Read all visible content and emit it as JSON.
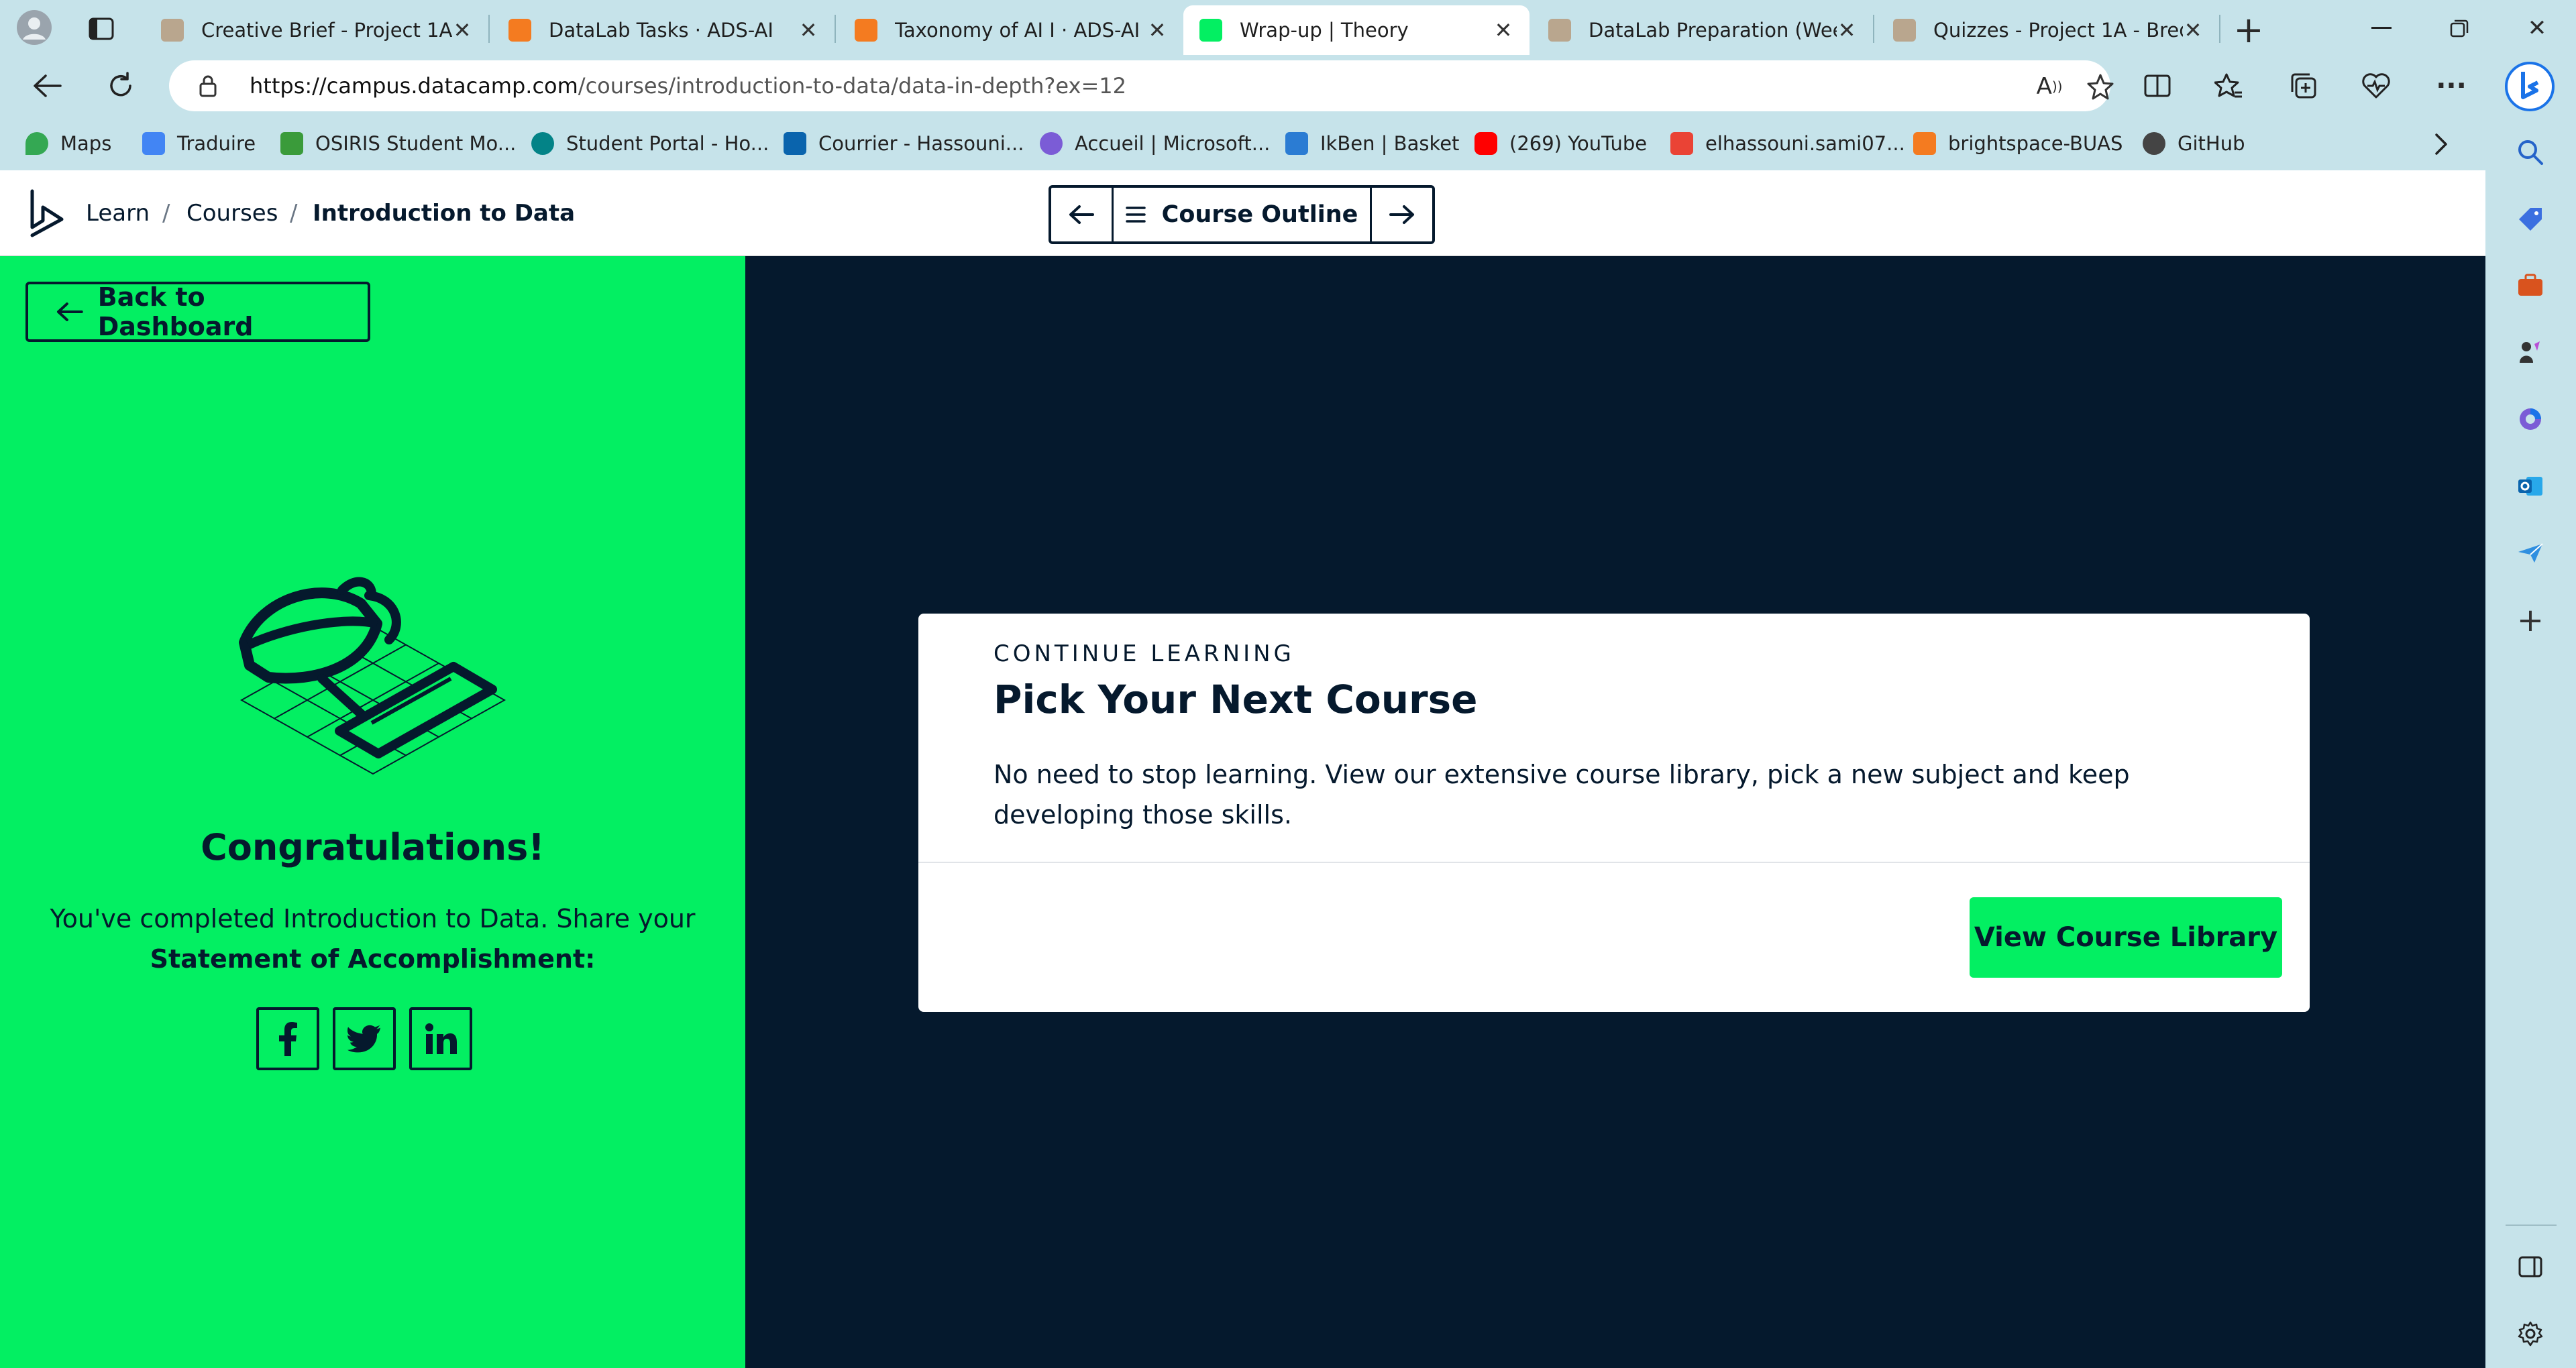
{
  "browser": {
    "tabs": [
      {
        "title": "Creative Brief - Project 1A",
        "favicon": "brightspace-icon",
        "color": "#b9a68e",
        "active": false
      },
      {
        "title": "DataLab Tasks · ADS-AI",
        "favicon": "brightspace-icon",
        "color": "#f47b20",
        "active": false
      },
      {
        "title": "Taxonomy of AI I · ADS-AI",
        "favicon": "brightspace-icon",
        "color": "#f47b20",
        "active": false
      },
      {
        "title": "Wrap-up | Theory",
        "favicon": "datacamp-icon",
        "color": "#03ef62",
        "active": true
      },
      {
        "title": "DataLab Preparation (Wee",
        "favicon": "brightspace-icon",
        "color": "#b9a68e",
        "active": false
      },
      {
        "title": "Quizzes - Project 1A - Bred",
        "favicon": "brightspace-icon",
        "color": "#b9a68e",
        "active": false
      }
    ],
    "url_domain": "https://campus.datacamp.com",
    "url_path": "/courses/introduction-to-data/data-in-depth?ex=12",
    "bookmarks": [
      {
        "label": "Maps",
        "icon": "maps-pin-icon",
        "color": "#34a853"
      },
      {
        "label": "Traduire",
        "icon": "translate-icon",
        "color": "#4285f4"
      },
      {
        "label": "OSIRIS Student Mo...",
        "icon": "osiris-icon",
        "color": "#3a9b3a"
      },
      {
        "label": "Student Portal - Ho...",
        "icon": "sharepoint-icon",
        "color": "#038387"
      },
      {
        "label": "Courrier - Hassouni...",
        "icon": "outlook-icon",
        "color": "#0a64ad"
      },
      {
        "label": "Accueil | Microsoft...",
        "icon": "microsoft-365-icon",
        "color": "#7b5cd6"
      },
      {
        "label": "IkBen | Basket",
        "icon": "ikben-icon",
        "color": "#2b7cd3"
      },
      {
        "label": "(269) YouTube",
        "icon": "youtube-icon",
        "color": "#ff0000"
      },
      {
        "label": "elhassouni.sami07...",
        "icon": "gmail-icon",
        "color": "#ea4335"
      },
      {
        "label": "brightspace-BUAS",
        "icon": "brightspace-icon",
        "color": "#f47b20"
      },
      {
        "label": "GitHub",
        "icon": "github-icon",
        "color": "#444444"
      }
    ]
  },
  "header": {
    "crumb_learn": "Learn",
    "crumb_sep1": "/",
    "crumb_courses": "Courses",
    "crumb_sep2": "/",
    "crumb_course": "Introduction to Data",
    "outline_label": "Course Outline"
  },
  "left": {
    "back_label": "Back to Dashboard",
    "congrats": "Congratulations!",
    "completed_text": "You've completed Introduction to Data. Share your",
    "statement_text": "Statement of Accomplishment:",
    "social": [
      "facebook-icon",
      "twitter-icon",
      "linkedin-icon"
    ]
  },
  "card": {
    "kicker": "CONTINUE LEARNING",
    "title": "Pick Your Next Course",
    "body": "No need to stop learning. View our extensive course library, pick a new subject and keep developing those skills.",
    "button": "View Course Library"
  },
  "colors": {
    "brand_green": "#03ef62",
    "navy": "#05192d",
    "chrome": "#c6e3ea"
  }
}
